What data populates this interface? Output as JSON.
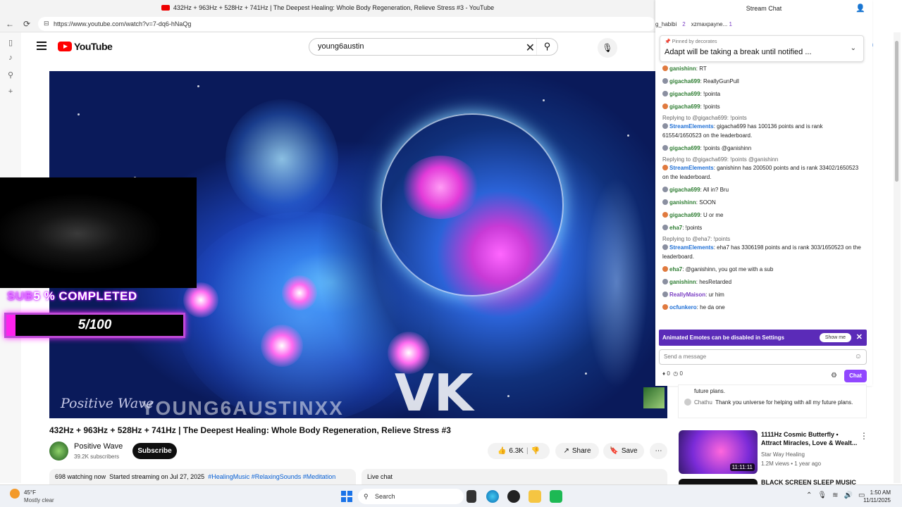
{
  "browser": {
    "tab_title": "432Hz + 963Hz + 528Hz + 741Hz | The Deepest Healing: Whole Body Regeneration, Relieve Stress #3 - YouTube",
    "url": "https://www.youtube.com/watch?v=7-dq6-hNaQg"
  },
  "youtube": {
    "logo_text": "YouTube",
    "search_value": "young6austin",
    "signin_partial": "in"
  },
  "video": {
    "watermark_left": "Positive Wave",
    "watermark_vk": "VK",
    "watermark_faint": "YOUNG6AUSTINXX",
    "overlay_text_faint": "SUB",
    "overlay_text": "5 % COMPLETED",
    "progress_label": "5/100",
    "progress_fraction": 0.05
  },
  "info": {
    "title": "432Hz + 963Hz + 528Hz + 741Hz | The Deepest Healing: Whole Body Regeneration, Relieve Stress #3",
    "channel": "Positive Wave",
    "subscribers": "39.2K subscribers",
    "subscribe_label": "Subscribe",
    "likes": "6.3K",
    "share_label": "Share",
    "save_label": "Save",
    "watching": "698 watching now",
    "started": "Started streaming on Jul 27, 2025",
    "tags": "#HealingMusic #RelaxingSounds #Meditation",
    "live_chat_label": "Live chat"
  },
  "stream_chat": {
    "title": "Stream Chat",
    "viewers": [
      {
        "name": "g_habibi",
        "count": ""
      },
      {
        "name": "",
        "count": "2"
      },
      {
        "name": "xzmaxpayne...",
        "count": "1"
      }
    ],
    "pinned_by_label": "Pinned by",
    "pinned_by": "decorates",
    "pinned_message": "Adapt will be taking a break until notified ...",
    "messages": [
      {
        "reply": "",
        "user": "ganishinn",
        "color": "#2e7d32",
        "text": ": RT"
      },
      {
        "reply": "",
        "user": "gigacha699",
        "color": "#2e7d32",
        "text": ": ReallyGunPull"
      },
      {
        "reply": "",
        "user": "gigacha699",
        "color": "#2e7d32",
        "text": ": !pointa"
      },
      {
        "reply": "",
        "user": "gigacha699",
        "color": "#2e7d32",
        "text": ": !points"
      },
      {
        "reply": "Replying to @gigacha699: !points",
        "user": "StreamElements",
        "color": "#1e6fd6",
        "text": ": gigacha699 has 100136 points and is rank 61554/1650523 on the leaderboard."
      },
      {
        "reply": "",
        "user": "gigacha699",
        "color": "#2e7d32",
        "text": ": !points @ganishinn"
      },
      {
        "reply": "Replying to @gigacha699: !points @ganishinn",
        "user": "StreamElements",
        "color": "#1e6fd6",
        "text": ": ganishinn has 200500 points and is rank 33402/1650523 on the leaderboard."
      },
      {
        "reply": "",
        "user": "gigacha699",
        "color": "#2e7d32",
        "text": ": All in? Bru"
      },
      {
        "reply": "",
        "user": "ganishinn",
        "color": "#2e7d32",
        "text": ": SOON"
      },
      {
        "reply": "",
        "user": "gigacha699",
        "color": "#2e7d32",
        "text": ": U or me"
      },
      {
        "reply": "",
        "user": "eha7",
        "color": "#2e7d32",
        "text": ": !points"
      },
      {
        "reply": "Replying to @eha7: !points",
        "user": "StreamElements",
        "color": "#1e6fd6",
        "text": ": eha7 has 3306198 points and is rank 303/1650523 on the leaderboard."
      },
      {
        "reply": "",
        "user": "eha7",
        "color": "#2e7d32",
        "text": ": @ganishinn, you got me with a sub"
      },
      {
        "reply": "",
        "user": "ganishinn",
        "color": "#2e7d32",
        "text": ": hesRetarded"
      },
      {
        "reply": "",
        "user": "ReallyMaison",
        "color": "#7b3fc4",
        "text": ": ur him"
      },
      {
        "reply": "",
        "user": "ocfunkero",
        "color": "#1e6fd6",
        "text": ": he da one"
      }
    ],
    "emote_banner": "Animated Emotes can be disabled in Settings",
    "show_me": "Show me",
    "send_placeholder": "Send a message",
    "points_a": "0",
    "points_b": "0",
    "chat_button": "Chat"
  },
  "yt_live_chat": {
    "line1": "future plans.",
    "line2_user": "Chathu",
    "line2_text": "Thank you universe for helping with all my future plans."
  },
  "recommendations": [
    {
      "title": "1111Hz Cosmic Butterfly • Attract Miracles, Love & Wealt...",
      "channel": "Star Way Healing",
      "meta": "1.2M views • 1 year ago",
      "duration": "11:11:11"
    },
    {
      "title": "BLACK SCREEN SLEEP MUSIC",
      "channel": "",
      "meta": "",
      "duration": ""
    }
  ],
  "taskbar": {
    "temp": "45°F",
    "weather": "Mostly clear",
    "search_label": "Search",
    "time": "1:50 AM",
    "date": "11/11/2025"
  }
}
